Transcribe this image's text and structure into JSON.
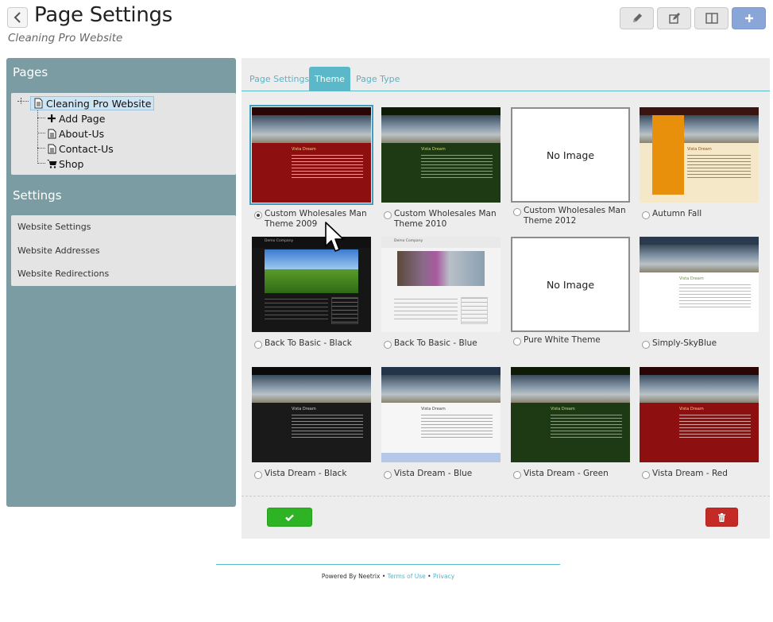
{
  "header": {
    "title": "Page Settings",
    "subtitle": "Cleaning Pro Website",
    "toolbar_icons": [
      "pencil-icon",
      "edit-icon",
      "columns-icon",
      "plus-icon"
    ]
  },
  "sidebar": {
    "pages_heading": "Pages",
    "tree": {
      "root": "Cleaning Pro Website",
      "children": [
        {
          "label": "Add Page",
          "icon": "plus-icon"
        },
        {
          "label": "About-Us",
          "icon": "document-icon"
        },
        {
          "label": "Contact-Us",
          "icon": "document-icon"
        },
        {
          "label": "Shop",
          "icon": "cart-icon"
        }
      ]
    },
    "settings_heading": "Settings",
    "settings_items": [
      "Website Settings",
      "Website Addresses",
      "Website Redirections"
    ]
  },
  "tabs": [
    {
      "label": "Page Settings",
      "active": false
    },
    {
      "label": "Theme",
      "active": true
    },
    {
      "label": "Page Type",
      "active": false
    }
  ],
  "themes": [
    {
      "label": "Custom Wholesales Man Theme 2009",
      "selected": true,
      "style": "red"
    },
    {
      "label": "Custom Wholesales Man Theme 2010",
      "selected": false,
      "style": "green"
    },
    {
      "label": "Custom Wholesales Man Theme 2012",
      "selected": false,
      "style": "none"
    },
    {
      "label": "Autumn Fall",
      "selected": false,
      "style": "autumn"
    },
    {
      "label": "Back To Basic - Black",
      "selected": false,
      "style": "basic-black"
    },
    {
      "label": "Back To Basic - Blue",
      "selected": false,
      "style": "basic-blue"
    },
    {
      "label": "Pure White Theme",
      "selected": false,
      "style": "none"
    },
    {
      "label": "Simply-SkyBlue",
      "selected": false,
      "style": "skyblue"
    },
    {
      "label": "Vista Dream - Black",
      "selected": false,
      "style": "black"
    },
    {
      "label": "Vista Dream - Blue",
      "selected": false,
      "style": "blue"
    },
    {
      "label": "Vista Dream - Green",
      "selected": false,
      "style": "green"
    },
    {
      "label": "Vista Dream - Red",
      "selected": false,
      "style": "red"
    }
  ],
  "no_image_text": "No Image",
  "preview_texts": {
    "vista_title": "Vista Dream",
    "company": "Demo Company"
  },
  "footer": {
    "powered": "Powered By Neetrix",
    "sep": "•",
    "terms": "Terms of Use",
    "privacy": "Privacy"
  },
  "colors": {
    "sidebar": "#7b9ca2",
    "accent": "#5bb8c8",
    "save": "#2db324",
    "delete": "#c42b26",
    "primary_button": "#8aa5d8"
  }
}
